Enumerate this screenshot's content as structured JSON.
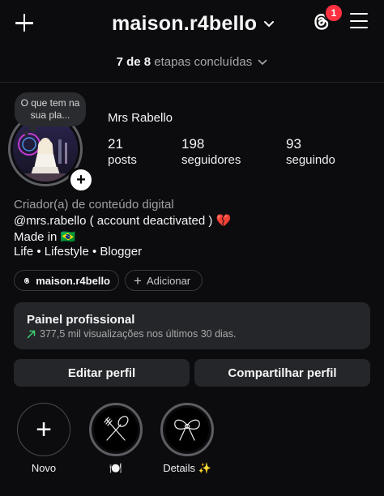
{
  "header": {
    "username": "maison.r4bello",
    "notification_count": "1"
  },
  "steps": {
    "completed_prefix": "7 de 8",
    "completed_suffix": "etapas concluídas"
  },
  "profile": {
    "note": "O que tem na sua pla...",
    "display_name": "Mrs Rabello",
    "stats": [
      {
        "value": "21",
        "label": "posts"
      },
      {
        "value": "198",
        "label": "seguidores"
      },
      {
        "value": "93",
        "label": "seguindo"
      }
    ]
  },
  "bio": {
    "category": "Criador(a) de conteúdo digital",
    "line1": "@mrs.rabello ( account deactivated ) 💔",
    "line2": "Made in 🇧🇷",
    "line3": "Life • Lifestyle • Blogger"
  },
  "chips": {
    "threads_handle": "maison.r4bello",
    "add_label": "Adicionar"
  },
  "panel": {
    "title": "Painel profissional",
    "subtitle": "377,5 mil visualizações nos últimos 30 dias."
  },
  "buttons": {
    "edit": "Editar perfil",
    "share": "Compartilhar perfil"
  },
  "highlights": [
    {
      "label": "Novo"
    },
    {
      "label": "🍽️"
    },
    {
      "label": "Details ✨"
    }
  ],
  "colors": {
    "background": "#0c0c0f",
    "badge": "#ff3040",
    "growth_arrow": "#3bd16f",
    "button_bg": "#25262a"
  }
}
